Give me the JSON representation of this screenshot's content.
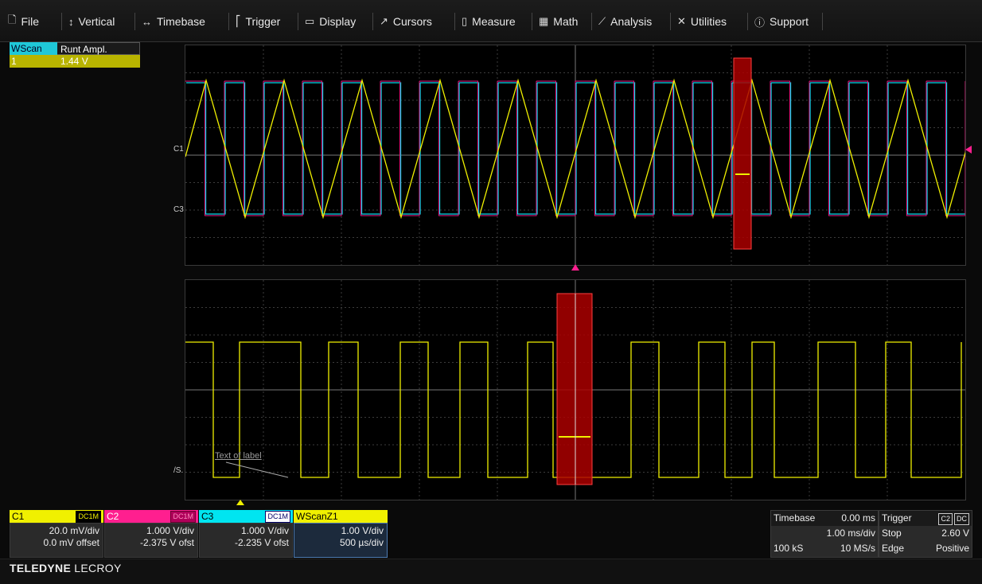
{
  "menu": {
    "items": [
      {
        "icon": "file-icon",
        "glyph": "🗋",
        "label": "File"
      },
      {
        "icon": "vertical-icon",
        "glyph": "↕",
        "label": "Vertical"
      },
      {
        "icon": "timebase-icon",
        "glyph": "↔",
        "label": "Timebase"
      },
      {
        "icon": "trigger-icon",
        "glyph": "⎡",
        "label": "Trigger"
      },
      {
        "icon": "display-icon",
        "glyph": "▭",
        "label": "Display"
      },
      {
        "icon": "cursors-icon",
        "glyph": "↗",
        "label": "Cursors"
      },
      {
        "icon": "measure-icon",
        "glyph": "▯",
        "label": "Measure"
      },
      {
        "icon": "math-icon",
        "glyph": "▦",
        "label": "Math"
      },
      {
        "icon": "analysis-icon",
        "glyph": "⟋",
        "label": "Analysis"
      },
      {
        "icon": "utilities-icon",
        "glyph": "✕",
        "label": "Utilities"
      },
      {
        "icon": "support-icon",
        "glyph": "ⓘ",
        "label": "Support"
      }
    ]
  },
  "measurement": {
    "col1_header": "WScan",
    "col2_header": "Runt Ampl.",
    "row_index": "1",
    "row_value": "1.44 V"
  },
  "grid": {
    "upper_c1_label": "C1",
    "upper_c3_label": "C3",
    "lower_marker": "/S.",
    "annotation": "Text of label"
  },
  "channels": [
    {
      "name": "C1",
      "coupling": "DC1M",
      "vdiv": "20.0 mV/div",
      "offset": "0.0 mV offset",
      "color": "#f0f000",
      "textcolor": "#000"
    },
    {
      "name": "C2",
      "coupling": "DC1M",
      "vdiv": "1.000 V/div",
      "offset": "-2.375 V ofst",
      "color": "#ff1f8f",
      "textcolor": "#000"
    },
    {
      "name": "C3",
      "coupling": "DC1M",
      "vdiv": "1.000 V/div",
      "offset": "-2.235 V ofst",
      "color": "#00e5f0",
      "textcolor": "#000"
    }
  ],
  "zoom": {
    "name": "WScanZ1",
    "vdiv": "1.00 V/div",
    "hdiv": "500 µs/div",
    "color": "#f0f000"
  },
  "timebase": {
    "label": "Timebase",
    "delay": "0.00 ms",
    "hdiv": "1.00 ms/div",
    "samples": "100 kS",
    "rate": "10 MS/s"
  },
  "trigger": {
    "label": "Trigger",
    "source": "C2",
    "coupling": "DC",
    "mode": "Stop",
    "level": "2.60 V",
    "type": "Edge",
    "slope": "Positive"
  },
  "brand": {
    "bold": "TELEDYNE",
    "light": " LECROY"
  }
}
